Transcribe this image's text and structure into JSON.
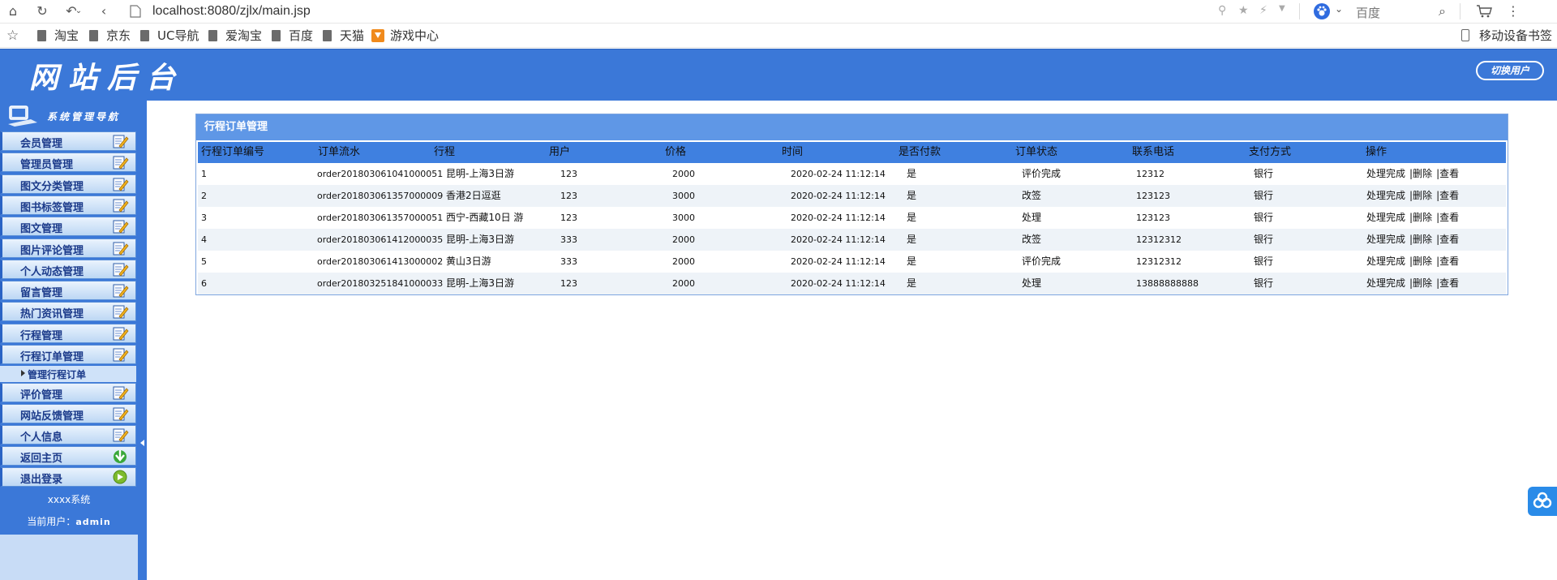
{
  "browser": {
    "url": "localhost:8080/zjlx/main.jsp",
    "search_placeholder": "百度",
    "bookmarks": [
      "淘宝",
      "京东",
      "UC导航",
      "爱淘宝",
      "百度",
      "天猫",
      "游戏中心"
    ],
    "mobile_bookmarks": "移动设备书签"
  },
  "header": {
    "title": "网站后台",
    "switch_user": "切换用户"
  },
  "sidebar": {
    "title": "系统管理导航",
    "items": [
      {
        "label": "会员管理",
        "icon": "edit-icon"
      },
      {
        "label": "管理员管理",
        "icon": "edit-icon"
      },
      {
        "label": "图文分类管理",
        "icon": "edit-icon"
      },
      {
        "label": "图书标签管理",
        "icon": "edit-icon"
      },
      {
        "label": "图文管理",
        "icon": "edit-icon"
      },
      {
        "label": "图片评论管理",
        "icon": "edit-icon"
      },
      {
        "label": "个人动态管理",
        "icon": "edit-icon"
      },
      {
        "label": "留言管理",
        "icon": "edit-icon"
      },
      {
        "label": "热门资讯管理",
        "icon": "edit-icon"
      },
      {
        "label": "行程管理",
        "icon": "edit-icon"
      },
      {
        "label": "行程订单管理",
        "icon": "edit-icon"
      }
    ],
    "sub_item": "管理行程订单",
    "items_after": [
      {
        "label": "评价管理",
        "icon": "edit-icon"
      },
      {
        "label": "网站反馈管理",
        "icon": "edit-icon"
      },
      {
        "label": "个人信息",
        "icon": "edit-icon"
      },
      {
        "label": "返回主页",
        "icon": "home-arrow-icon"
      },
      {
        "label": "退出登录",
        "icon": "logout-icon"
      }
    ],
    "system_name": "xxxx系统",
    "current_user_label": "当前用户：",
    "current_user": "admin"
  },
  "panel": {
    "title": "行程订单管理",
    "columns": [
      "行程订单编号",
      "订单流水",
      "行程",
      "用户",
      "价格",
      "时间",
      "是否付款",
      "订单状态",
      "联系电话",
      "支付方式",
      "操作"
    ],
    "rows": [
      [
        "1",
        "order201803061041000051",
        "昆明-上海3日游",
        "123",
        "2000",
        "2020-02-24 11:12:14",
        "是",
        "评价完成",
        "12312",
        "银行"
      ],
      [
        "2",
        "order201803061357000009",
        "香港2日逗逛",
        "123",
        "3000",
        "2020-02-24 11:12:14",
        "是",
        "改签",
        "123123",
        "银行"
      ],
      [
        "3",
        "order201803061357000051",
        "西宁-西藏10日 游",
        "123",
        "3000",
        "2020-02-24 11:12:14",
        "是",
        "处理",
        "123123",
        "银行"
      ],
      [
        "4",
        "order201803061412000035",
        "昆明-上海3日游",
        "333",
        "2000",
        "2020-02-24 11:12:14",
        "是",
        "改签",
        "12312312",
        "银行"
      ],
      [
        "5",
        "order201803061413000002",
        "黄山3日游",
        "333",
        "2000",
        "2020-02-24 11:12:14",
        "是",
        "评价完成",
        "12312312",
        "银行"
      ],
      [
        "6",
        "order201803251841000033",
        "昆明-上海3日游",
        "123",
        "2000",
        "2020-02-24 11:12:14",
        "是",
        "处理",
        "13888888888",
        "银行"
      ]
    ],
    "actions": [
      "处理完成",
      "|删除",
      "|查看"
    ]
  },
  "colors": {
    "header_blue": "#3b78d8",
    "panel_title_blue": "#5f97e6",
    "table_head_blue": "#3f80e0"
  }
}
